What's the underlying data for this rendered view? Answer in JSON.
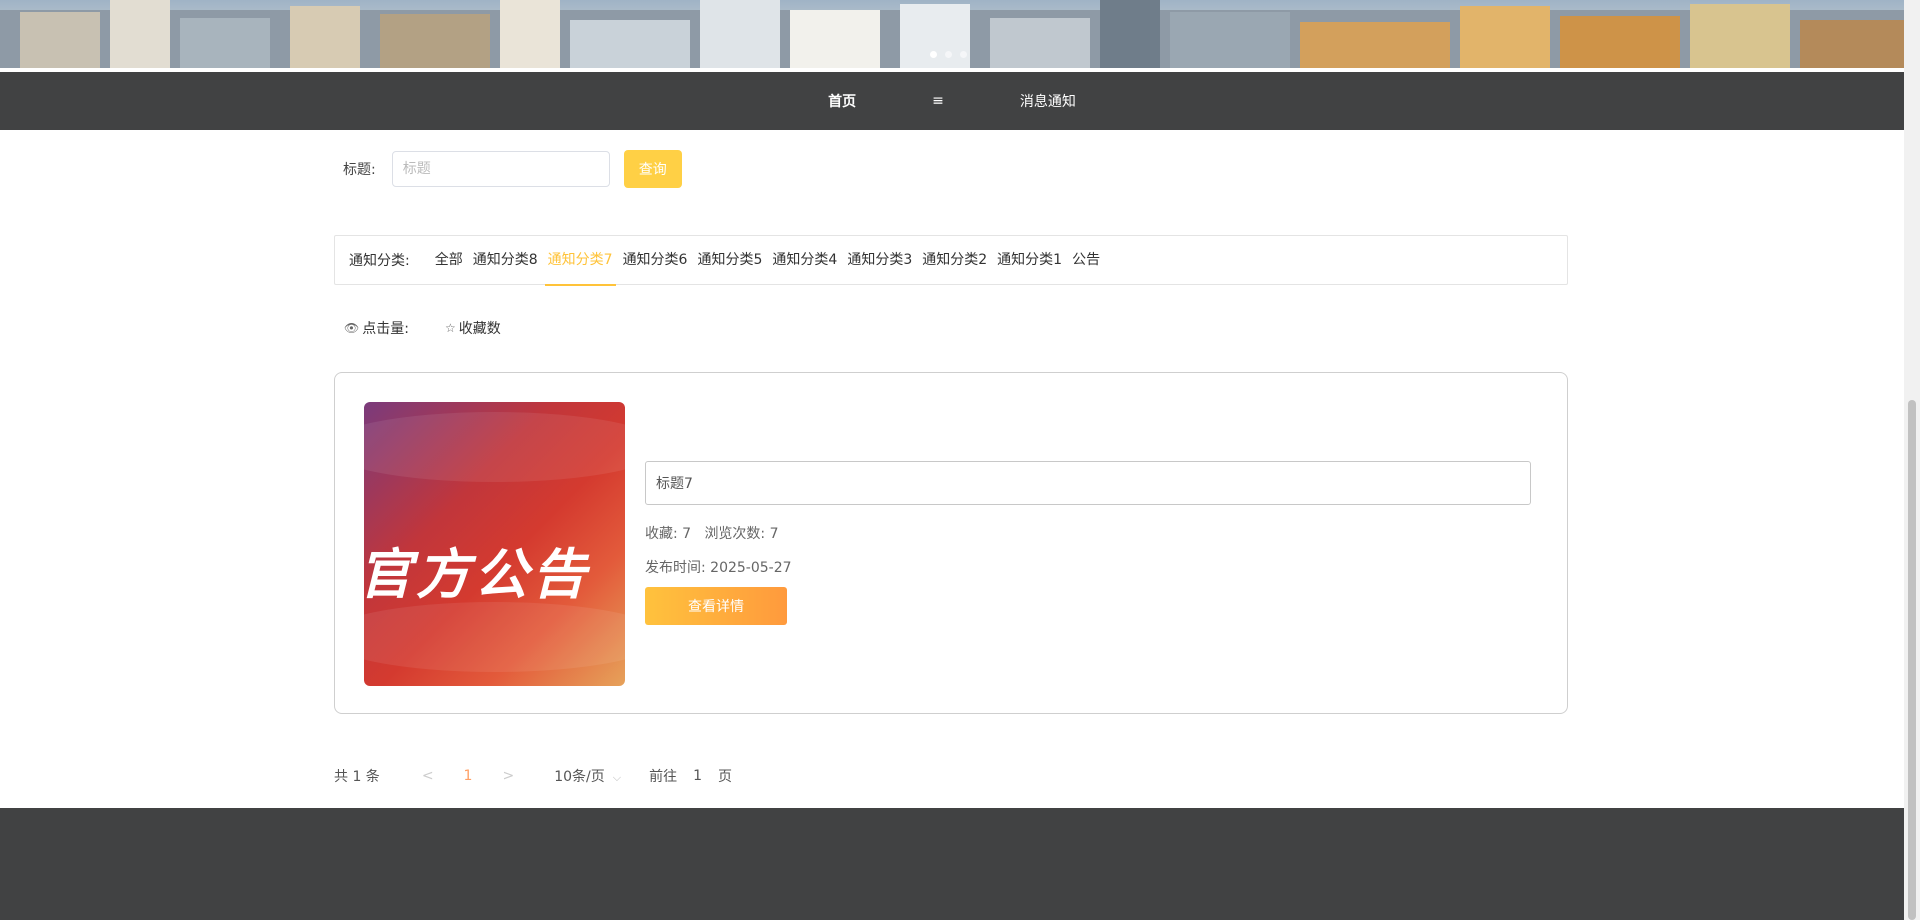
{
  "nav": {
    "home": "首页",
    "menu_icon": "≡",
    "notice": "消息通知"
  },
  "search": {
    "label": "标题:",
    "placeholder": "标题",
    "button": "查询"
  },
  "categories": {
    "label": "通知分类:",
    "items": [
      "全部",
      "通知分类8",
      "通知分类7",
      "通知分类6",
      "通知分类5",
      "通知分类4",
      "通知分类3",
      "通知分类2",
      "通知分类1",
      "公告"
    ],
    "active": "通知分类7"
  },
  "sort": {
    "clicks": "点击量:",
    "favorites": "收藏数"
  },
  "card": {
    "image_text": "官方公告",
    "title": "标题7",
    "favorites_label": "收藏: 7",
    "views_label": "浏览次数: 7",
    "publish_label": "发布时间: 2025-05-27",
    "detail_button": "查看详情"
  },
  "pager": {
    "total": "共 1 条",
    "prev": "<",
    "page": "1",
    "next": ">",
    "page_size": "10条/页",
    "goto_prefix": "前往",
    "goto_value": "1",
    "goto_suffix": "页"
  },
  "colors": {
    "accent": "#ffc339",
    "nav_bg": "#414243",
    "button_bg": "#ffd045"
  }
}
